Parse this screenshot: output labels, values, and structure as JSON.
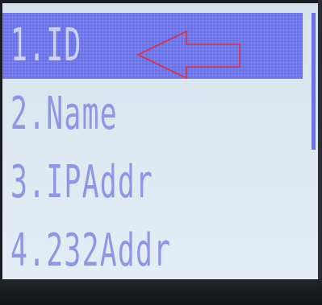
{
  "menu": {
    "items": [
      {
        "label": "1.ID",
        "selected": true
      },
      {
        "label": "2.Name",
        "selected": false
      },
      {
        "label": "3.IPAddr",
        "selected": false
      },
      {
        "label": "4.232Addr",
        "selected": false
      }
    ]
  },
  "scrollbar": {
    "visible_fraction": 0.5,
    "position_fraction": 0.0
  },
  "colors": {
    "highlight": "#6a72e4",
    "text": "#8f96e6",
    "screen_bg": "#dde7f0",
    "annotation": "#e0303a"
  },
  "annotation": {
    "icon": "left-arrow-icon",
    "points_to": "1.ID"
  }
}
